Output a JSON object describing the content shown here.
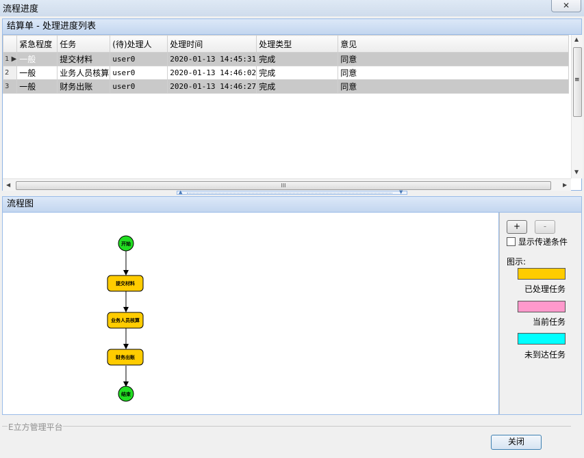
{
  "window": {
    "title": "流程进度",
    "close_glyph": "✕"
  },
  "list_panel": {
    "title": "结算单 - 处理进度列表"
  },
  "grid": {
    "columns": [
      "紧急程度",
      "任务",
      "(待)处理人",
      "处理时间",
      "处理类型",
      "意见"
    ],
    "rows": [
      {
        "num": "1",
        "urgency": "一般",
        "task": "提交材料",
        "handler": "user0",
        "time": "2020-01-13 14:45:31",
        "type": "完成",
        "opinion": "同意"
      },
      {
        "num": "2",
        "urgency": "一般",
        "task": "业务人员核算",
        "handler": "user0",
        "time": "2020-01-13 14:46:02",
        "type": "完成",
        "opinion": "同意"
      },
      {
        "num": "3",
        "urgency": "一般",
        "task": "财务出账",
        "handler": "user0",
        "time": "2020-01-13 14:46:27",
        "type": "完成",
        "opinion": "同意"
      }
    ],
    "hscroll_grip": "III",
    "vscroll_grip": "≡"
  },
  "flow_panel": {
    "title": "流程图"
  },
  "flow": {
    "nodes": [
      {
        "label": "开始",
        "kind": "start"
      },
      {
        "label": "提交材料",
        "kind": "task"
      },
      {
        "label": "业务人员核算",
        "kind": "task"
      },
      {
        "label": "财务出账",
        "kind": "task"
      },
      {
        "label": "结束",
        "kind": "end"
      }
    ],
    "colors": {
      "done": "#ffcc00",
      "terminal": "#22dd22"
    }
  },
  "legend": {
    "zoom_in": "+",
    "zoom_out": "-",
    "show_condition_label": "显示传递条件",
    "caption": "图示:",
    "items": [
      {
        "label": "已处理任务",
        "color": "#ffcc00"
      },
      {
        "label": "当前任务",
        "color": "#ff99cc"
      },
      {
        "label": "未到达任务",
        "color": "#00ffff"
      }
    ]
  },
  "footer": {
    "platform": "E立方管理平台",
    "close_label": "关闭"
  }
}
